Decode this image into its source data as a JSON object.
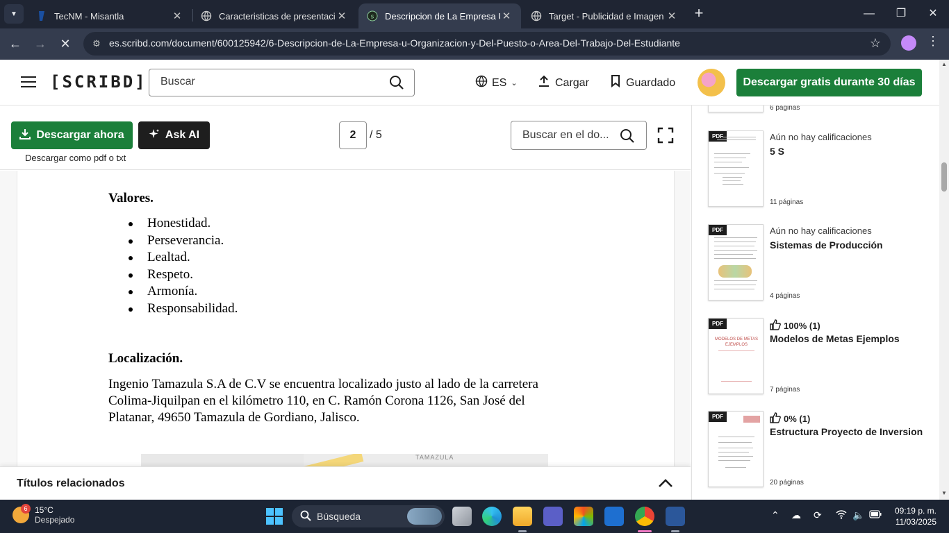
{
  "browser": {
    "tabs": [
      {
        "title": "TecNM - Misantla",
        "active": false
      },
      {
        "title": "Caracteristicas de presentacion",
        "active": false
      },
      {
        "title": "Descripcion de La Empresa U O",
        "active": true
      },
      {
        "title": "Target - Publicidad e Imagen",
        "active": false
      }
    ],
    "url": "es.scribd.com/document/600125942/6-Descripcion-de-La-Empresa-u-Organizacion-y-Del-Puesto-o-Area-Del-Trabajo-Del-Estudiante"
  },
  "header": {
    "logo": "[SCRIBD]",
    "search_placeholder": "Buscar",
    "lang": "ES",
    "upload": "Cargar",
    "saved": "Guardado",
    "cta": "Descargar gratis durante 30 días"
  },
  "toolbar": {
    "download_now": "Descargar ahora",
    "ask_ai": "Ask AI",
    "download_sub": "Descargar como pdf o txt",
    "page_current": "2",
    "page_total": "/ 5",
    "doc_search_placeholder": "Buscar en el do..."
  },
  "document": {
    "valores_heading": "Valores.",
    "valores": [
      "Honestidad.",
      "Perseverancia.",
      "Lealtad.",
      "Respeto.",
      "Armonía.",
      "Responsabilidad."
    ],
    "localizacion_heading": "Localización.",
    "localizacion_text": "Ingenio Tamazula S.A de C.V se encuentra localizado justo al lado de la carretera Colima-Jiquilpan en el kilómetro 110, en C. Ramón Corona 1126, San José del Platanar, 49650 Tamazula de Gordiano, Jalisco.",
    "map_label": "TAMAZULA"
  },
  "related": {
    "title": "Títulos relacionados"
  },
  "rail": {
    "top_partial_pages": "6 páginas",
    "cards": [
      {
        "rating": "Aún no hay calificaciones",
        "title": "5 S",
        "pages": "11 páginas",
        "thumb_badge": "PDF"
      },
      {
        "rating": "Aún no hay calificaciones",
        "title": "Sistemas de Producción",
        "pages": "4 páginas",
        "thumb_badge": "PDF"
      },
      {
        "rating": "100% (1)",
        "title": "Modelos de Metas Ejemplos",
        "pages": "7 páginas",
        "thumb_badge": "PDF",
        "thumb_text": "MODELOS DE METAS EJEMPLOS"
      },
      {
        "rating": "0% (1)",
        "title": "Estructura Proyecto de Inversion",
        "pages": "20 páginas",
        "thumb_badge": "PDF"
      }
    ]
  },
  "taskbar": {
    "weather_temp": "15°C",
    "weather_desc": "Despejado",
    "weather_badge": "6",
    "search_label": "Búsqueda",
    "time": "09:19 p. m.",
    "date": "11/03/2025"
  },
  "colors": {
    "brand_green": "#1b7f3a",
    "chrome_dark": "#1f2533",
    "chrome_mid": "#343c4e"
  }
}
